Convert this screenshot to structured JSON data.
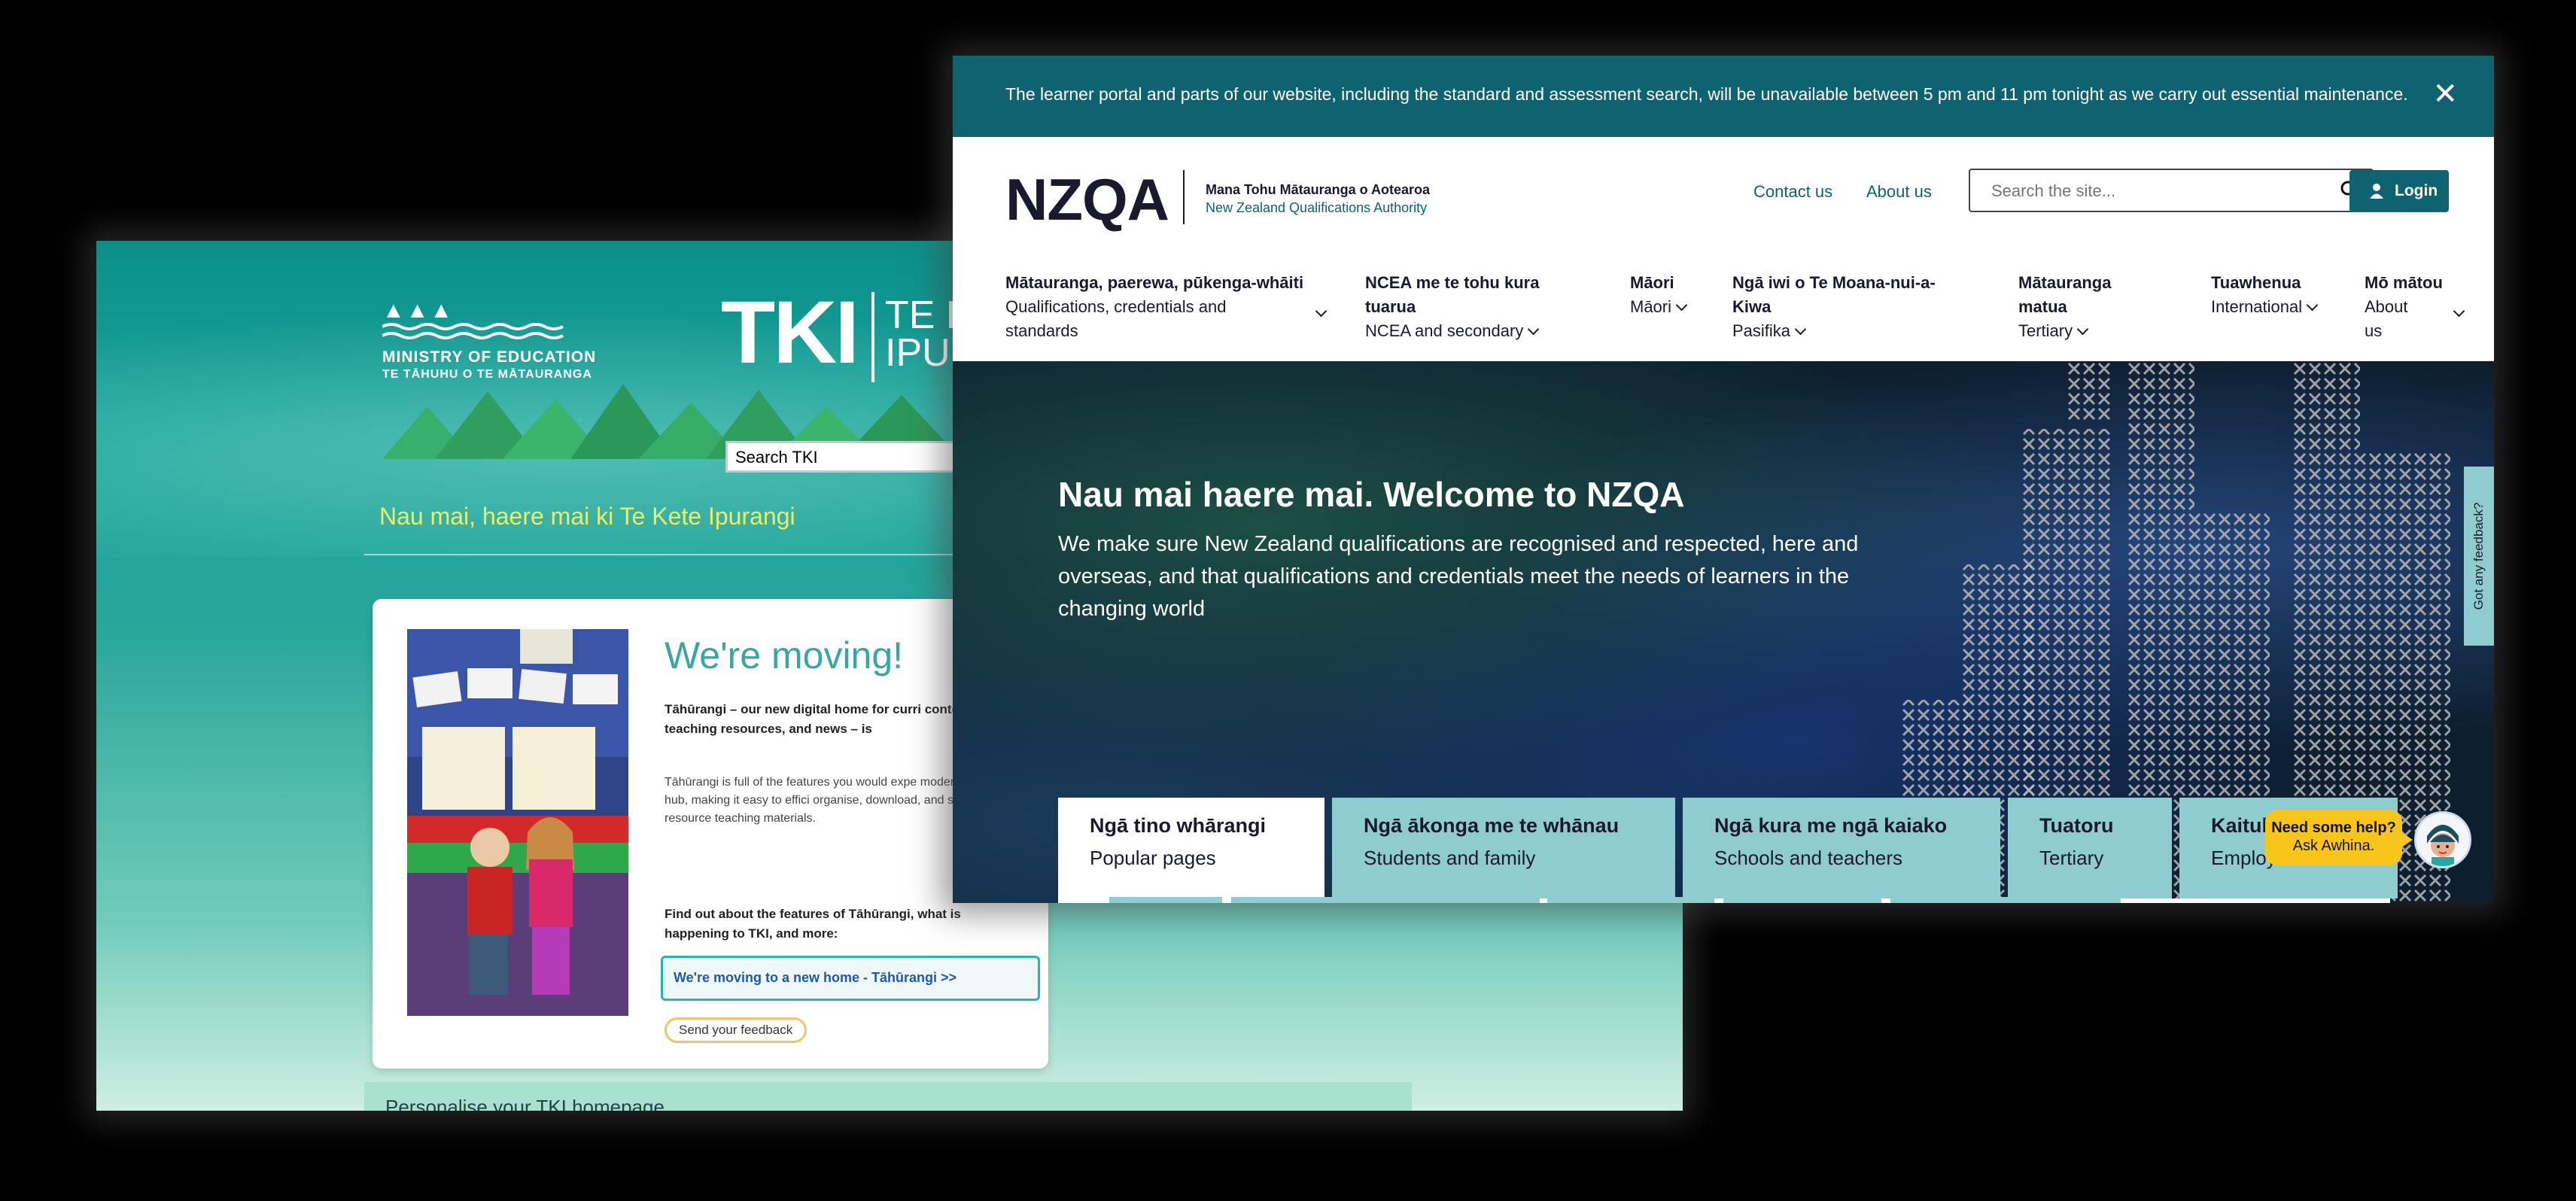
{
  "tki": {
    "moe_line1": "MINISTRY OF EDUCATION",
    "moe_line2": "TE TĀHUHU O TE MĀTAURANGA",
    "logo_main": "TKI",
    "logo_side": "TE K IPU",
    "search_placeholder": "Search TKI",
    "welcome": "Nau mai, haere mai ki Te Kete Ipurangi",
    "card": {
      "heading": "We're moving!",
      "intro": "Tāhūrangi – our new digital home for curri content, teaching resources, and news – is",
      "body": "Tāhūrangi is full of the features you would expe modern curriculum hub, making it easy to effici organise, download, and share quality resource teaching materials.",
      "find_out": "Find out about the features of Tāhūrangi, what is happening to TKI, and more:",
      "link_label": "We're moving to a new home - Tāhūrangi >>",
      "feedback": "Send your feedback"
    },
    "personalise": "Personalise your TKI homepage"
  },
  "nzqa": {
    "banner": "The learner portal and parts of our website, including the standard and assessment search, will be unavailable between 5 pm and 11 pm tonight as we carry out essential maintenance.",
    "close_icon": "✕",
    "logo": "NZQA",
    "tagline_mi": "Mana Tohu Mātauranga o Aotearoa",
    "tagline_en": "New Zealand Qualifications Authority",
    "contact": "Contact us",
    "about": "About us",
    "search_placeholder": "Search the site...",
    "login": "Login",
    "menu": [
      {
        "mi": "Mātauranga, paerewa, pūkenga-whāiti",
        "en": "Qualifications, credentials and standards"
      },
      {
        "mi": "NCEA me te tohu kura tuarua",
        "en": "NCEA and secondary"
      },
      {
        "mi": "Māori",
        "en": "Māori"
      },
      {
        "mi": "Ngā iwi o Te Moana-nui-a-Kiwa",
        "en": "Pasifika"
      },
      {
        "mi": "Mātauranga matua",
        "en": "Tertiary"
      },
      {
        "mi": "Tuawhenua",
        "en": "International"
      },
      {
        "mi": "Mō mātou",
        "en": "About us"
      }
    ],
    "hero_title": "Nau mai haere mai. Welcome to NZQA",
    "hero_sub": "We make sure New Zealand qualifications are recognised and respected, here and overseas, and that qualifications and credentials meet the needs of learners in the changing world",
    "tabs": [
      {
        "mi": "Ngā tino whārangi",
        "en": "Popular pages"
      },
      {
        "mi": "Ngā ākonga me te whānau",
        "en": "Students and family"
      },
      {
        "mi": "Ngā kura me ngā kaiako",
        "en": "Schools and teachers"
      },
      {
        "mi": "Tuatoru",
        "en": "Tertiary"
      },
      {
        "mi": "Kaitukumahi",
        "en": "Employers"
      }
    ],
    "help_line1": "Need some help?",
    "help_line2": "Ask Awhina.",
    "feedback_tab": "Got any feedback?"
  },
  "colors": {
    "nzqa_teal": "#0f6270",
    "tab_teal": "#8fccd0",
    "tki_teal": "#16a39a",
    "help_yellow": "#f8c61b"
  },
  "icons": [
    "close-icon",
    "search-icon",
    "user-icon",
    "chevron-down-icon",
    "awhina-avatar-icon"
  ]
}
